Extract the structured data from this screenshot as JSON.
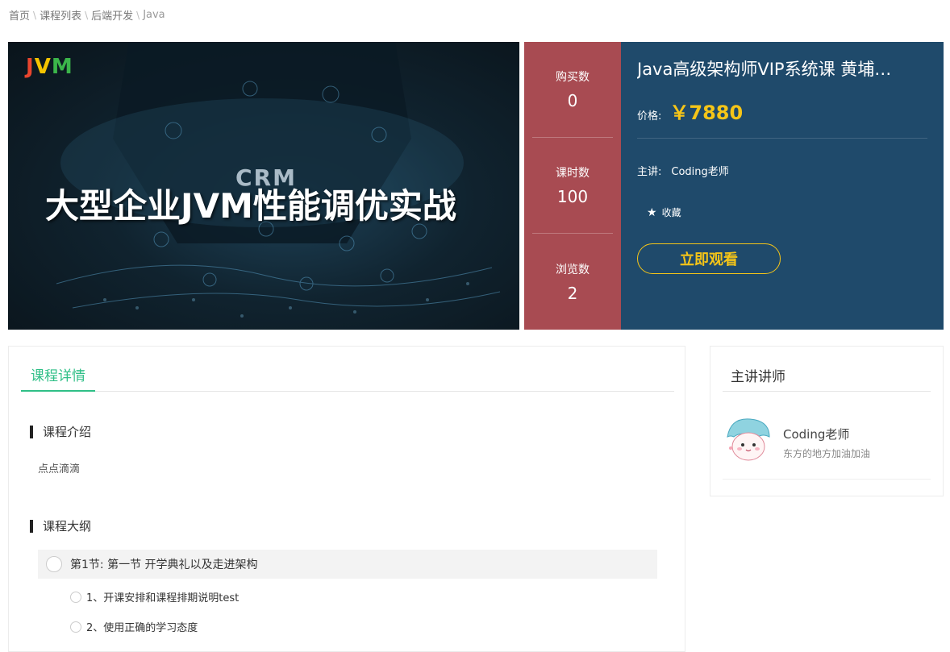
{
  "breadcrumb": {
    "home": "首页",
    "list": "课程列表",
    "category": "后端开发",
    "current": "Java",
    "separator": "\\"
  },
  "hero": {
    "logo_j": "J",
    "logo_v": "V",
    "logo_m": "M",
    "crm_label": "CRM",
    "banner_title": "大型企业JVM性能调优实战"
  },
  "stats": [
    {
      "label": "购买数",
      "value": "0"
    },
    {
      "label": "课时数",
      "value": "100"
    },
    {
      "label": "浏览数",
      "value": "2"
    }
  ],
  "course": {
    "title": "Java高级架构师VIP系统课 黄埔…",
    "price_label": "价格:",
    "price": "￥7880",
    "teacher_label": "主讲:",
    "teacher": "Coding老师",
    "favorite_label": "收藏",
    "favorite_icon": "star-icon",
    "watch_button": "立即观看"
  },
  "detail": {
    "tab_label": "课程详情",
    "intro_heading": "课程介绍",
    "intro_text": "点点滴滴",
    "outline_heading": "课程大纲",
    "chapter": "第1节: 第一节 开学典礼以及走进架构",
    "lessons": [
      "1、开课安排和课程排期说明test",
      "2、使用正确的学习态度"
    ]
  },
  "lecturer": {
    "heading": "主讲讲师",
    "name": "Coding老师",
    "description": "东方的地方加油加油"
  },
  "colors": {
    "stats_bg": "#a84b52",
    "info_bg": "#1f4a6b",
    "accent_yellow": "#f5c518",
    "tab_green": "#2fbf87"
  }
}
